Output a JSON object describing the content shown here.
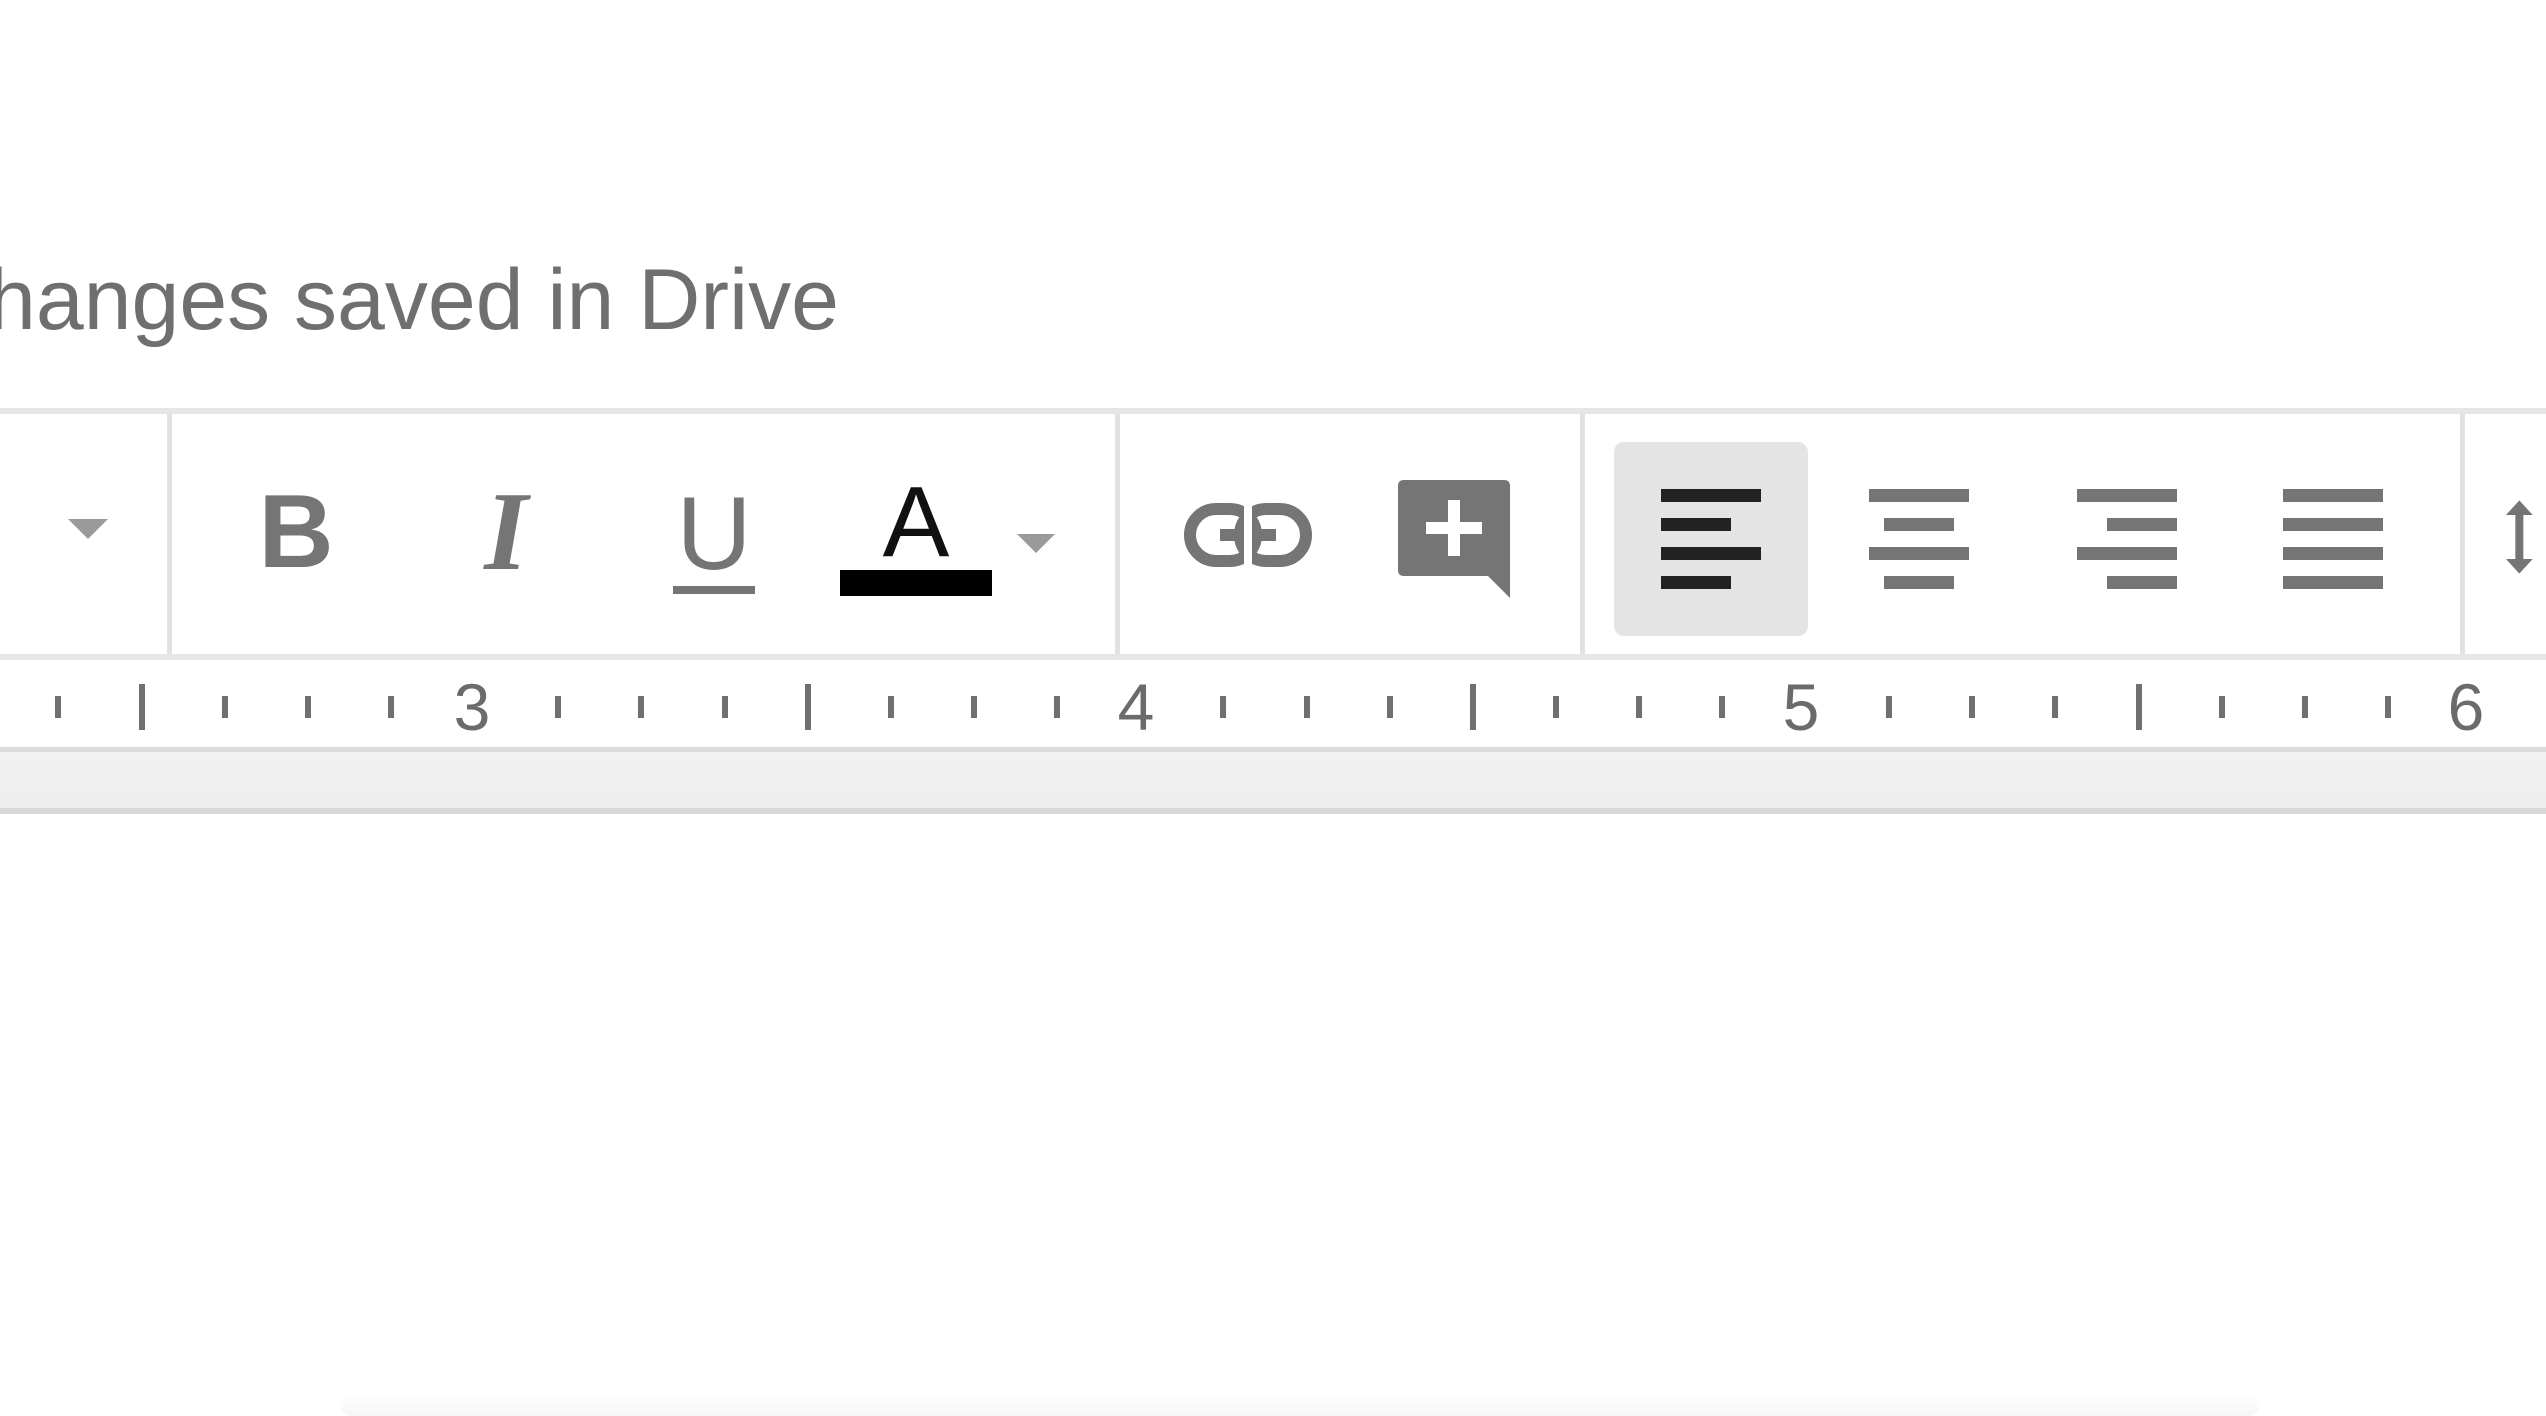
{
  "header": {
    "save_status": "hanges saved in Drive"
  },
  "toolbar": {
    "bold_label": "B",
    "italic_label": "I",
    "underline_label": "U",
    "text_color_label": "A",
    "text_color_value": "#000000",
    "active_alignment": "left",
    "icons": {
      "dropdown": "chevron-down-icon",
      "bold": "bold-icon",
      "italic": "italic-icon",
      "underline": "underline-icon",
      "text_color": "text-color-icon",
      "link": "link-icon",
      "comment": "add-comment-icon",
      "align_left": "align-left-icon",
      "align_center": "align-center-icon",
      "align_right": "align-right-icon",
      "justify": "justify-icon",
      "line_spacing": "line-spacing-icon"
    }
  },
  "ruler": {
    "numbers": [
      "3",
      "4",
      "5",
      "6"
    ]
  },
  "colors": {
    "icon_gray": "#757575",
    "active_icon": "#222222",
    "active_bg": "#e4e4e4",
    "text_color_bar": "#000000"
  }
}
